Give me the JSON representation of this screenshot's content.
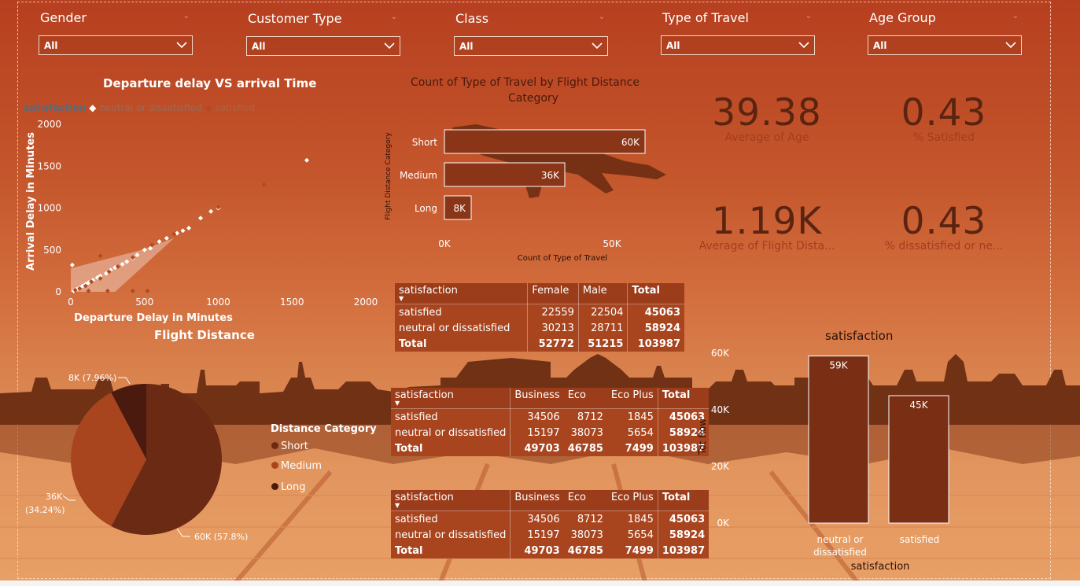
{
  "slicers": [
    {
      "title": "Gender",
      "value": "All"
    },
    {
      "title": "Customer Type",
      "value": "All"
    },
    {
      "title": "Class",
      "value": "All"
    },
    {
      "title": "Type of Travel",
      "value": "All"
    },
    {
      "title": "Age Group",
      "value": "All"
    }
  ],
  "scatter": {
    "title": "Departure delay VS arrival Time",
    "legend_title": "satisfaction",
    "legend_items": [
      "neutral or dissatisfied",
      "satisfied"
    ],
    "xlabel": "Departure Delay in Minutes",
    "ylabel": "Arrival Delay in Minutes",
    "xticks": [
      "0",
      "500",
      "1000",
      "1500",
      "2000"
    ],
    "yticks": [
      "2000",
      "1500",
      "1000",
      "500",
      "0"
    ],
    "colors": {
      "neutral": "#ffffff",
      "satisfied": "#b24a22"
    }
  },
  "bar": {
    "title_line1": "Count of Type of Travel by Flight Distance",
    "title_line2": "Category",
    "ylabel": "Flight Distance Category",
    "xlabel": "Count of Type of Travel",
    "xticks": [
      "0K",
      "50K"
    ]
  },
  "kpis": [
    {
      "value": "39.38",
      "label": "Average of Age"
    },
    {
      "value": "0.43",
      "label": "% Satisfied"
    },
    {
      "value": "1.19K",
      "label": "Average of Flight Dista..."
    },
    {
      "value": "0.43",
      "label": "% dissatisfied or ne..."
    }
  ],
  "gender_table": {
    "headers": [
      "satisfaction",
      "Female",
      "Male",
      "Total"
    ],
    "rows": [
      [
        "satisfied",
        "22559",
        "22504",
        "45063"
      ],
      [
        "neutral or dissatisfied",
        "30213",
        "28711",
        "58924"
      ]
    ],
    "total": [
      "Total",
      "52772",
      "51215",
      "103987"
    ]
  },
  "class_table": {
    "headers": [
      "satisfaction",
      "Business",
      "Eco",
      "Eco Plus",
      "Total"
    ],
    "rows": [
      [
        "satisfied",
        "34506",
        "8712",
        "1845",
        "45063"
      ],
      [
        "neutral or dissatisfied",
        "15197",
        "38073",
        "5654",
        "58924"
      ]
    ],
    "total": [
      "Total",
      "49703",
      "46785",
      "7499",
      "103987"
    ]
  },
  "class_table2": {
    "headers": [
      "satisfaction",
      "Business",
      "Eco",
      "Eco Plus",
      "Total"
    ],
    "rows": [
      [
        "satisfied",
        "34506",
        "8712",
        "1845",
        "45063"
      ],
      [
        "neutral or dissatisfied",
        "15197",
        "38073",
        "5654",
        "58924"
      ]
    ],
    "total": [
      "Total",
      "49703",
      "46785",
      "7499",
      "103987"
    ]
  },
  "pie": {
    "title": "Flight Distance",
    "legend_title": "Distance Category",
    "legend": [
      "Short",
      "Medium",
      "Long"
    ],
    "labels": {
      "short": "60K (57.8%)",
      "medium_1": "36K",
      "medium_2": "(34.24%)",
      "long": "8K (7.96%)"
    },
    "colors": {
      "short": "#6b2a14",
      "medium": "#a8451f",
      "long": "#4a1a0e"
    }
  },
  "col": {
    "title": "satisfaction",
    "ylabel": "Tot Row",
    "xlabel": "satisfaction",
    "yticks": [
      "60K",
      "40K",
      "20K",
      "0K"
    ],
    "cat1_line1": "neutral or",
    "cat1_line2": "dissatisfied",
    "cat2": "satisfied"
  },
  "chart_data": [
    {
      "type": "scatter",
      "title": "Departure delay VS arrival Time",
      "xlabel": "Departure Delay in Minutes",
      "ylabel": "Arrival Delay in Minutes",
      "xlim": [
        0,
        2000
      ],
      "ylim": [
        0,
        2000
      ],
      "series": [
        {
          "name": "neutral or dissatisfied",
          "points": [
            [
              1600,
              1570
            ],
            [
              1000,
              1000
            ],
            [
              950,
              960
            ],
            [
              880,
              880
            ],
            [
              800,
              760
            ],
            [
              760,
              730
            ],
            [
              720,
              700
            ],
            [
              650,
              640
            ],
            [
              600,
              600
            ],
            [
              540,
              520
            ],
            [
              500,
              500
            ],
            [
              450,
              440
            ],
            [
              420,
              400
            ],
            [
              380,
              360
            ],
            [
              350,
              330
            ],
            [
              300,
              290
            ],
            [
              270,
              260
            ],
            [
              240,
              220
            ],
            [
              200,
              190
            ],
            [
              180,
              170
            ],
            [
              150,
              140
            ],
            [
              120,
              110
            ],
            [
              100,
              90
            ],
            [
              80,
              70
            ],
            [
              60,
              50
            ],
            [
              40,
              30
            ],
            [
              20,
              10
            ],
            [
              10,
              320
            ]
          ]
        },
        {
          "name": "satisfied",
          "points": [
            [
              1310,
              1280
            ],
            [
              1000,
              1010
            ],
            [
              700,
              690
            ],
            [
              550,
              560
            ],
            [
              420,
              410
            ],
            [
              320,
              300
            ],
            [
              260,
              240
            ],
            [
              200,
              160
            ],
            [
              140,
              120
            ],
            [
              100,
              70
            ],
            [
              60,
              40
            ],
            [
              30,
              20
            ],
            [
              200,
              430
            ],
            [
              250,
              10
            ],
            [
              120,
              10
            ],
            [
              420,
              10
            ],
            [
              520,
              10
            ]
          ]
        }
      ]
    },
    {
      "type": "bar",
      "title": "Count of Type of Travel by Flight Distance Category",
      "categories": [
        "Short",
        "Medium",
        "Long"
      ],
      "values": [
        60000,
        36000,
        8000
      ],
      "labels": [
        "60K",
        "36K",
        "8K"
      ],
      "xlabel": "Count of Type of Travel",
      "ylabel": "Flight Distance Category"
    },
    {
      "type": "pie",
      "title": "Flight Distance",
      "categories": [
        "Short",
        "Medium",
        "Long"
      ],
      "values": [
        60000,
        36000,
        8000
      ],
      "percent": [
        57.8,
        34.24,
        7.96
      ]
    },
    {
      "type": "bar",
      "title": "satisfaction",
      "categories": [
        "neutral or dissatisfied",
        "satisfied"
      ],
      "values": [
        59000,
        45000
      ],
      "labels": [
        "59K",
        "45K"
      ],
      "ylim": [
        0,
        60000
      ],
      "xlabel": "satisfaction",
      "ylabel": "Tot Row"
    }
  ]
}
